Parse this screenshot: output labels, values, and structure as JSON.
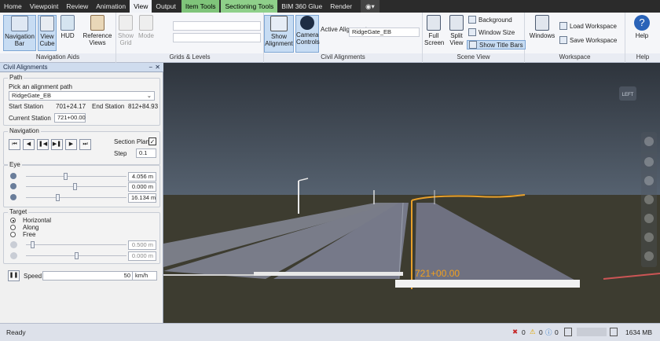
{
  "tabs": [
    "Home",
    "Viewpoint",
    "Review",
    "Animation",
    "View",
    "Output",
    "Item Tools",
    "Sectioning Tools",
    "BIM 360 Glue",
    "Render"
  ],
  "ribbon": {
    "navigation_bar": "Navigation Bar",
    "view_cube": "View Cube",
    "hud": "HUD",
    "reference_views": "Reference Views",
    "show_grid": "Show Grid",
    "mode": "Mode",
    "show_alignment": "Show Alignment",
    "camera_controls": "Camera Controls",
    "active_alignment": "Active Alignment",
    "alignment_value": "RidgeGate_EB",
    "full_screen": "Full Screen",
    "split_view": "Split View",
    "background": "Background",
    "window_size": "Window Size",
    "show_title_bars": "Show Title Bars",
    "windows": "Windows",
    "load_workspace": "Load Workspace",
    "save_workspace": "Save Workspace",
    "help": "Help",
    "groups": {
      "navigation_aids": "Navigation Aids",
      "grids_levels": "Grids & Levels",
      "civil_alignments": "Civil Alignments",
      "scene_view": "Scene View",
      "workspace": "Workspace",
      "help": "Help"
    }
  },
  "panel": {
    "title": "Civil Alignments",
    "path_legend": "Path",
    "pick_label": "Pick an alignment path",
    "alignment": "RidgeGate_EB",
    "start_station_label": "Start Station",
    "start_station": "701+24.17",
    "end_station_label": "End Station",
    "end_station": "812+84.93",
    "current_station_label": "Current Station",
    "current_station": "721+00.00",
    "navigation_legend": "Navigation",
    "section_plane_label": "Section Plane",
    "step_label": "Step",
    "step_value": "0.1",
    "eye_legend": "Eye",
    "eye_values": [
      "4.056 m",
      "0.000 m",
      "16.134 m"
    ],
    "target_legend": "Target",
    "target_options": [
      "Horizontal",
      "Along",
      "Free"
    ],
    "target_values": [
      "0.500 m",
      "0.000 m"
    ],
    "speed_label": "Speed",
    "speed_value": "50",
    "speed_unit": "km/h"
  },
  "viewport": {
    "station_label": "721+00.00",
    "cube_label": "LEFT"
  },
  "status": {
    "ready": "Ready",
    "errors": "0",
    "warnings": "0",
    "info": "0",
    "memory": "1634 MB"
  },
  "colors": {
    "accent": "#1f6fc6",
    "station_label": "#f0a020",
    "sky": "#3c4550",
    "ground": "#3d3b2e",
    "road": "#6e6f7e"
  }
}
